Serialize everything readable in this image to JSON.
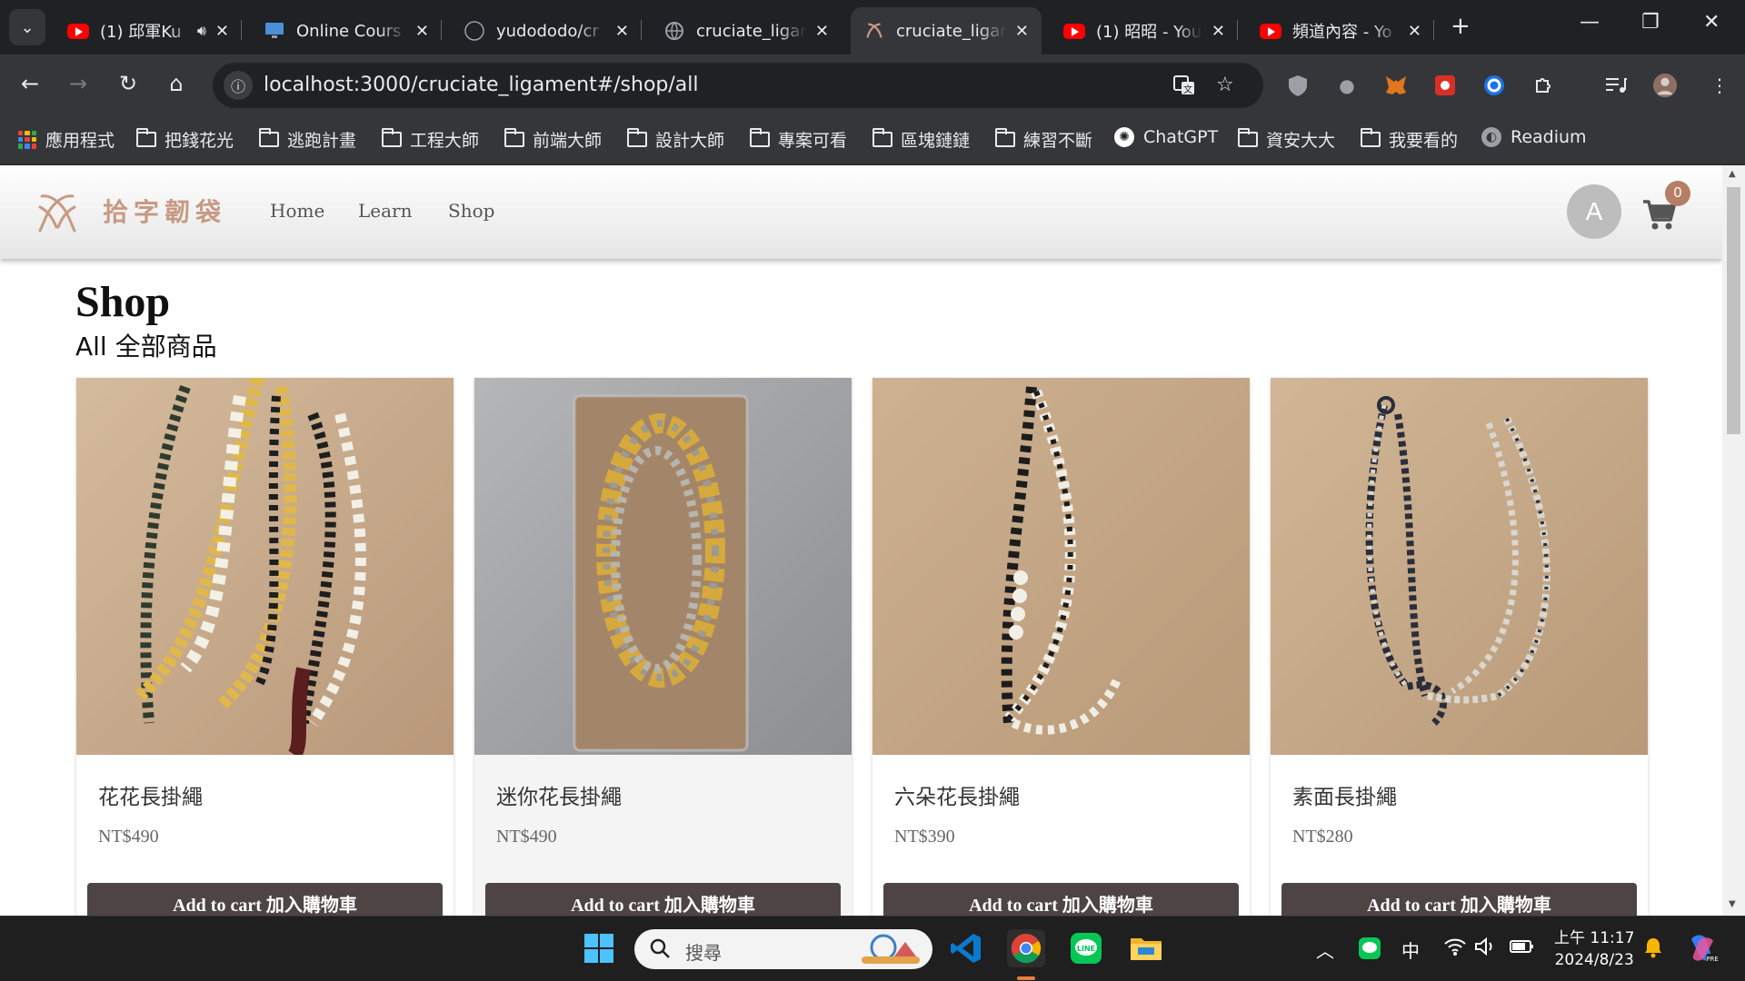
{
  "browser": {
    "tabs": [
      {
        "title": "(1) 邱軍Ku",
        "favicon": "youtube-icon"
      },
      {
        "title": "Online Cours",
        "favicon": "monitor-icon"
      },
      {
        "title": "yudododo/cr",
        "favicon": "github-icon"
      },
      {
        "title": "cruciate_ligar",
        "favicon": "globe-icon"
      },
      {
        "title": "cruciate_ligar",
        "favicon": "site-logo-icon",
        "active": true
      },
      {
        "title": "(1) 昭昭 - You",
        "favicon": "youtube-icon"
      },
      {
        "title": "頻道內容 - Yo",
        "favicon": "youtube-icon"
      }
    ],
    "url": "localhost:3000/cruciate_ligament#/shop/all",
    "bookmarks": [
      {
        "label": "應用程式",
        "icon": "apps-grid-icon"
      },
      {
        "label": "把錢花光",
        "icon": "folder-icon"
      },
      {
        "label": "逃跑計畫",
        "icon": "folder-icon"
      },
      {
        "label": "工程大師",
        "icon": "folder-icon"
      },
      {
        "label": "前端大師",
        "icon": "folder-icon"
      },
      {
        "label": "設計大師",
        "icon": "folder-icon"
      },
      {
        "label": "專案可看",
        "icon": "folder-icon"
      },
      {
        "label": "區塊鏈鏈",
        "icon": "folder-icon"
      },
      {
        "label": "練習不斷",
        "icon": "folder-icon"
      },
      {
        "label": "ChatGPT",
        "icon": "chatgpt-icon"
      },
      {
        "label": "資安大大",
        "icon": "folder-icon"
      },
      {
        "label": "我要看的",
        "icon": "folder-icon"
      },
      {
        "label": "Readium",
        "icon": "readium-icon"
      }
    ]
  },
  "site": {
    "brand": "拾字韌袋",
    "nav": [
      "Home",
      "Learn",
      "Shop"
    ],
    "avatar_letter": "A",
    "cart_count": "0"
  },
  "page": {
    "title": "Shop",
    "subtitle": "All 全部商品"
  },
  "products": [
    {
      "name": "花花長掛繩",
      "price": "NT$490",
      "button": "Add to cart 加入購物車"
    },
    {
      "name": "迷你花長掛繩",
      "price": "NT$490",
      "button": "Add to cart 加入購物車"
    },
    {
      "name": "六朵花長掛繩",
      "price": "NT$390",
      "button": "Add to cart 加入購物車"
    },
    {
      "name": "素面長掛繩",
      "price": "NT$280",
      "button": "Add to cart 加入購物車"
    }
  ],
  "taskbar": {
    "search_placeholder": "搜尋",
    "ime": "中",
    "time": "上午 11:17",
    "date": "2024/8/23"
  },
  "colors": {
    "accent": "#c79a83",
    "button": "#4e4444",
    "badge": "#b57e65"
  }
}
